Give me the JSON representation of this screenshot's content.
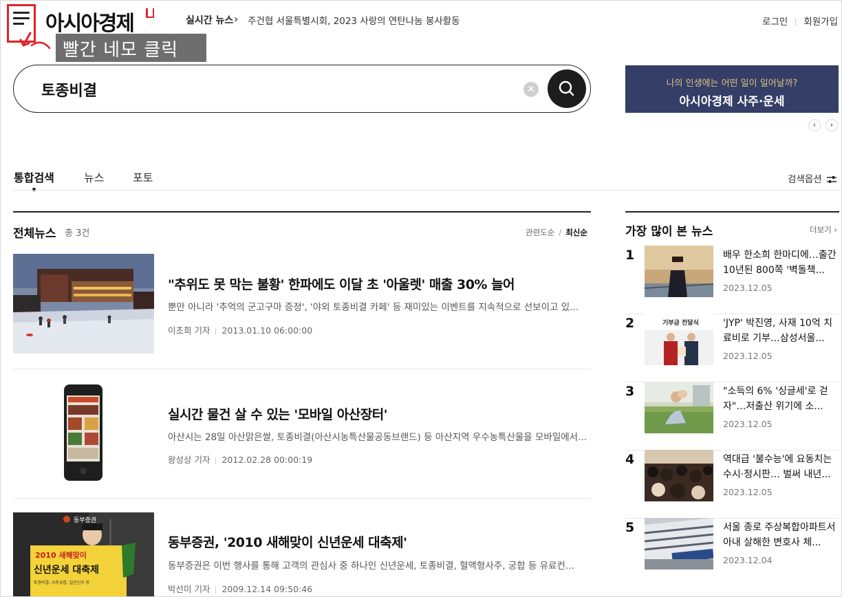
{
  "header": {
    "logo_text": "아시아경제",
    "annotation": "빨간 네모 클릭",
    "realtime_label": "실시간 뉴스",
    "realtime_headline": "주건협 서울특별시회, 2023 사랑의 연탄나눔 봉사활동",
    "login": "로그인",
    "signup": "회원가입"
  },
  "search": {
    "query": "토종비결",
    "clear_glyph": "✕"
  },
  "banner": {
    "subtitle": "나의 인생에는 어떤 일이 일어날까?",
    "title": "아시아경제 사주·운세",
    "prev_glyph": "‹",
    "next_glyph": "›"
  },
  "tabs": {
    "items": [
      "통합검색",
      "뉴스",
      "포토"
    ],
    "active_index": 0,
    "options_label": "검색옵션"
  },
  "news": {
    "section_title": "전체뉴스",
    "count": "총 3건",
    "sort_relevance": "관련도순",
    "sort_sep": "/",
    "sort_latest": "최신순",
    "articles": [
      {
        "title": "\"추위도 못 막는 불황' 한파에도 이달 초 '아울렛' 매출 30% 늘어",
        "summary": "뿐만 아니라 '추억의 군고구마 증정', '야외 토종비결 카페' 등 재미있는 이벤트를 지속적으로 선보이고 있...",
        "reporter": "이초희 기자",
        "date": "2013.01.10 06:00:00"
      },
      {
        "title": "실시간 물건 살 수 있는 '모바일 아산장터'",
        "summary": "아산시는 28일 아산맑은쌀, 토종비결(아산시농특산물공동브랜드) 등 아산지역 우수농특산물을 모바일에서...",
        "reporter": "왕성상 기자",
        "date": "2012.02.28 00:00:19"
      },
      {
        "title": "동부증권, '2010 새해맞이 신년운세 대축제'",
        "summary": "동부증권은 이번 행사를 통해 고객의 관심사 중 하나인 신년운세, 토종비결, 혈액형사주, 궁합 등 유료컨...",
        "reporter": "박선미 기자",
        "date": "2009.12.14 09:50:46"
      }
    ],
    "thumb3_sign": "동부증권",
    "thumb3_board_top": "2010 새해맞이",
    "thumb3_board_main": "신년운세 대축제",
    "thumb3_board_sub": "토정비결, 사주궁합, 일년신수 등"
  },
  "popular": {
    "title": "가장 많이 본 뉴스",
    "more": "더보기 ›",
    "items": [
      {
        "rank": "1",
        "headline": "배우 한소희 한마디에…출간 10년된 800쪽 '벽돌책...",
        "date": "2023.12.05"
      },
      {
        "rank": "2",
        "headline": "'JYP' 박진영, 사재 10억 치료비로 기부…삼성서울...",
        "date": "2023.12.05"
      },
      {
        "rank": "3",
        "headline": "\"소득의 6% '싱글세'로 걷자\"…저출산 위기에 소...",
        "date": "2023.12.05"
      },
      {
        "rank": "4",
        "headline": "역대급 '불수능'에 요동치는 수시·정시판… 벌써 내년...",
        "date": "2023.12.05"
      },
      {
        "rank": "5",
        "headline": "서울 종로 주상복합아파트서 아내 살해한 변호사 체...",
        "date": "2023.12.04"
      }
    ],
    "thumb2_caption": "기부금 전달식"
  }
}
